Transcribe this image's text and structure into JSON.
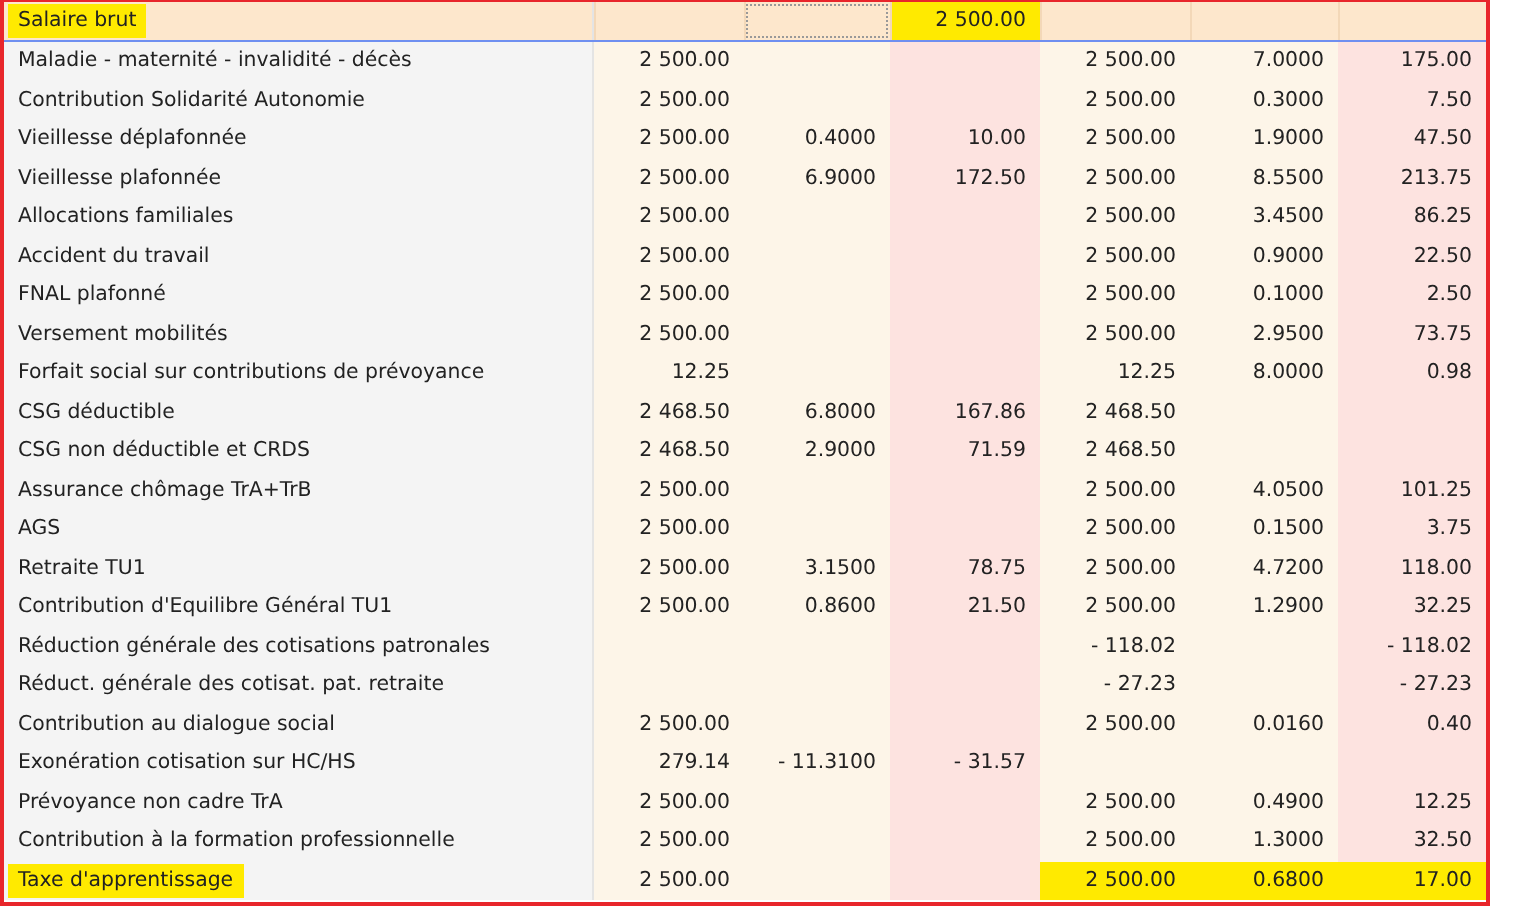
{
  "header_row": {
    "label": "Salaire brut",
    "label_highlighted": true,
    "cells": [
      null,
      {
        "focused": true
      },
      {
        "text": "2 500.00",
        "highlighted": true
      },
      null,
      null,
      null
    ]
  },
  "rows": [
    {
      "label": "Maladie - maternité - invalidité - décès",
      "label_highlighted": false,
      "cells": [
        {
          "text": "2 500.00",
          "highlighted": false
        },
        null,
        null,
        {
          "text": "2 500.00",
          "highlighted": false
        },
        {
          "text": "7.0000",
          "highlighted": false
        },
        {
          "text": "175.00",
          "highlighted": false
        }
      ]
    },
    {
      "label": "Contribution Solidarité Autonomie",
      "label_highlighted": false,
      "cells": [
        {
          "text": "2 500.00",
          "highlighted": false
        },
        null,
        null,
        {
          "text": "2 500.00",
          "highlighted": false
        },
        {
          "text": "0.3000",
          "highlighted": false
        },
        {
          "text": "7.50",
          "highlighted": false
        }
      ]
    },
    {
      "label": "Vieillesse déplafonnée",
      "label_highlighted": false,
      "cells": [
        {
          "text": "2 500.00",
          "highlighted": false
        },
        {
          "text": "0.4000",
          "highlighted": false
        },
        {
          "text": "10.00",
          "highlighted": false
        },
        {
          "text": "2 500.00",
          "highlighted": false
        },
        {
          "text": "1.9000",
          "highlighted": false
        },
        {
          "text": "47.50",
          "highlighted": false
        }
      ]
    },
    {
      "label": "Vieillesse plafonnée",
      "label_highlighted": false,
      "cells": [
        {
          "text": "2 500.00",
          "highlighted": false
        },
        {
          "text": "6.9000",
          "highlighted": false
        },
        {
          "text": "172.50",
          "highlighted": false
        },
        {
          "text": "2 500.00",
          "highlighted": false
        },
        {
          "text": "8.5500",
          "highlighted": false
        },
        {
          "text": "213.75",
          "highlighted": false
        }
      ]
    },
    {
      "label": "Allocations familiales",
      "label_highlighted": false,
      "cells": [
        {
          "text": "2 500.00",
          "highlighted": false
        },
        null,
        null,
        {
          "text": "2 500.00",
          "highlighted": false
        },
        {
          "text": "3.4500",
          "highlighted": false
        },
        {
          "text": "86.25",
          "highlighted": false
        }
      ]
    },
    {
      "label": "Accident du travail",
      "label_highlighted": false,
      "cells": [
        {
          "text": "2 500.00",
          "highlighted": false
        },
        null,
        null,
        {
          "text": "2 500.00",
          "highlighted": false
        },
        {
          "text": "0.9000",
          "highlighted": false
        },
        {
          "text": "22.50",
          "highlighted": false
        }
      ]
    },
    {
      "label": "FNAL plafonné",
      "label_highlighted": false,
      "cells": [
        {
          "text": "2 500.00",
          "highlighted": false
        },
        null,
        null,
        {
          "text": "2 500.00",
          "highlighted": false
        },
        {
          "text": "0.1000",
          "highlighted": false
        },
        {
          "text": "2.50",
          "highlighted": false
        }
      ]
    },
    {
      "label": "Versement mobilités",
      "label_highlighted": false,
      "cells": [
        {
          "text": "2 500.00",
          "highlighted": false
        },
        null,
        null,
        {
          "text": "2 500.00",
          "highlighted": false
        },
        {
          "text": "2.9500",
          "highlighted": false
        },
        {
          "text": "73.75",
          "highlighted": false
        }
      ]
    },
    {
      "label": "Forfait social sur contributions de prévoyance",
      "label_highlighted": false,
      "cells": [
        {
          "text": "12.25",
          "highlighted": false
        },
        null,
        null,
        {
          "text": "12.25",
          "highlighted": false
        },
        {
          "text": "8.0000",
          "highlighted": false
        },
        {
          "text": "0.98",
          "highlighted": false
        }
      ]
    },
    {
      "label": "CSG déductible",
      "label_highlighted": false,
      "cells": [
        {
          "text": "2 468.50",
          "highlighted": false
        },
        {
          "text": "6.8000",
          "highlighted": false
        },
        {
          "text": "167.86",
          "highlighted": false
        },
        {
          "text": "2 468.50",
          "highlighted": false
        },
        null,
        null
      ]
    },
    {
      "label": "CSG non déductible et CRDS",
      "label_highlighted": false,
      "cells": [
        {
          "text": "2 468.50",
          "highlighted": false
        },
        {
          "text": "2.9000",
          "highlighted": false
        },
        {
          "text": "71.59",
          "highlighted": false
        },
        {
          "text": "2 468.50",
          "highlighted": false
        },
        null,
        null
      ]
    },
    {
      "label": "Assurance chômage TrA+TrB",
      "label_highlighted": false,
      "cells": [
        {
          "text": "2 500.00",
          "highlighted": false
        },
        null,
        null,
        {
          "text": "2 500.00",
          "highlighted": false
        },
        {
          "text": "4.0500",
          "highlighted": false
        },
        {
          "text": "101.25",
          "highlighted": false
        }
      ]
    },
    {
      "label": "AGS",
      "label_highlighted": false,
      "cells": [
        {
          "text": "2 500.00",
          "highlighted": false
        },
        null,
        null,
        {
          "text": "2 500.00",
          "highlighted": false
        },
        {
          "text": "0.1500",
          "highlighted": false
        },
        {
          "text": "3.75",
          "highlighted": false
        }
      ]
    },
    {
      "label": "Retraite TU1",
      "label_highlighted": false,
      "cells": [
        {
          "text": "2 500.00",
          "highlighted": false
        },
        {
          "text": "3.1500",
          "highlighted": false
        },
        {
          "text": "78.75",
          "highlighted": false
        },
        {
          "text": "2 500.00",
          "highlighted": false
        },
        {
          "text": "4.7200",
          "highlighted": false
        },
        {
          "text": "118.00",
          "highlighted": false
        }
      ]
    },
    {
      "label": "Contribution d'Equilibre Général TU1",
      "label_highlighted": false,
      "cells": [
        {
          "text": "2 500.00",
          "highlighted": false
        },
        {
          "text": "0.8600",
          "highlighted": false
        },
        {
          "text": "21.50",
          "highlighted": false
        },
        {
          "text": "2 500.00",
          "highlighted": false
        },
        {
          "text": "1.2900",
          "highlighted": false
        },
        {
          "text": "32.25",
          "highlighted": false
        }
      ]
    },
    {
      "label": "Réduction générale des cotisations patronales",
      "label_highlighted": false,
      "cells": [
        null,
        null,
        null,
        {
          "text": "- 118.02",
          "highlighted": false
        },
        null,
        {
          "text": "- 118.02",
          "highlighted": false
        }
      ]
    },
    {
      "label": "Réduct. générale des cotisat. pat. retraite",
      "label_highlighted": false,
      "cells": [
        null,
        null,
        null,
        {
          "text": "- 27.23",
          "highlighted": false
        },
        null,
        {
          "text": "- 27.23",
          "highlighted": false
        }
      ]
    },
    {
      "label": "Contribution au dialogue social",
      "label_highlighted": false,
      "cells": [
        {
          "text": "2 500.00",
          "highlighted": false
        },
        null,
        null,
        {
          "text": "2 500.00",
          "highlighted": false
        },
        {
          "text": "0.0160",
          "highlighted": false
        },
        {
          "text": "0.40",
          "highlighted": false
        }
      ]
    },
    {
      "label": "Exonération cotisation sur HC/HS",
      "label_highlighted": false,
      "cells": [
        {
          "text": "279.14",
          "highlighted": false
        },
        {
          "text": "- 11.3100",
          "highlighted": false
        },
        {
          "text": "- 31.57",
          "highlighted": false
        },
        null,
        null,
        null
      ]
    },
    {
      "label": "Prévoyance non cadre TrA",
      "label_highlighted": false,
      "cells": [
        {
          "text": "2 500.00",
          "highlighted": false
        },
        null,
        null,
        {
          "text": "2 500.00",
          "highlighted": false
        },
        {
          "text": "0.4900",
          "highlighted": false
        },
        {
          "text": "12.25",
          "highlighted": false
        }
      ]
    },
    {
      "label": "Contribution à la formation professionnelle",
      "label_highlighted": false,
      "cells": [
        {
          "text": "2 500.00",
          "highlighted": false
        },
        null,
        null,
        {
          "text": "2 500.00",
          "highlighted": false
        },
        {
          "text": "1.3000",
          "highlighted": false
        },
        {
          "text": "32.50",
          "highlighted": false
        }
      ]
    },
    {
      "label": "Taxe d'apprentissage",
      "label_highlighted": true,
      "cells": [
        {
          "text": "2 500.00",
          "highlighted": false
        },
        null,
        null,
        {
          "text": "2 500.00",
          "highlighted": true
        },
        {
          "text": "0.6800",
          "highlighted": true
        },
        {
          "text": "17.00",
          "highlighted": true
        }
      ]
    }
  ]
}
